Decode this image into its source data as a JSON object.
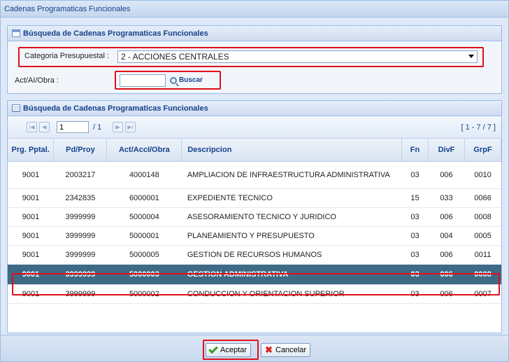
{
  "window": {
    "title": "Cadenas Programaticas Funcionales"
  },
  "search_panel": {
    "title": "Búsqueda de Cadenas Programaticas Funcionales",
    "category_label": "Categoria Presupuestal :",
    "category_value": "2 - ACCIONES CENTRALES",
    "act_label": "Act/AI/Obra :",
    "act_value": "",
    "search_button": "Buscar"
  },
  "grid_panel": {
    "title": "Búsqueda de Cadenas Programaticas Funcionales",
    "pager": {
      "page": "1",
      "of_pages": "/ 1",
      "range": "[ 1 - 7 / 7 ]"
    },
    "columns": [
      "Prg. Pptal.",
      "Pd/Proy",
      "Act/AccI/Obra",
      "Descripcion",
      "Fn",
      "DivF",
      "GrpF"
    ],
    "rows": [
      [
        "9001",
        "2003217",
        "4000148",
        "AMPLIACION DE INFRAESTRUCTURA ADMINISTRATIVA",
        "03",
        "006",
        "0010"
      ],
      [
        "9001",
        "2342835",
        "6000001",
        "EXPEDIENTE TECNICO",
        "15",
        "033",
        "0066"
      ],
      [
        "9001",
        "3999999",
        "5000004",
        "ASESORAMIENTO TECNICO Y JURIDICO",
        "03",
        "006",
        "0008"
      ],
      [
        "9001",
        "3999999",
        "5000001",
        "PLANEAMIENTO Y PRESUPUESTO",
        "03",
        "004",
        "0005"
      ],
      [
        "9001",
        "3999999",
        "5000005",
        "GESTION DE RECURSOS HUMANOS",
        "03",
        "006",
        "0011"
      ],
      [
        "9001",
        "3999999",
        "5000003",
        "GESTION ADMINISTRATIVA",
        "03",
        "006",
        "0008"
      ],
      [
        "9001",
        "3999999",
        "5000002",
        "CONDUCCION Y ORIENTACION SUPERIOR",
        "03",
        "006",
        "0007"
      ]
    ],
    "selected_row": 5
  },
  "footer": {
    "accept": "Aceptar",
    "cancel": "Cancelar"
  },
  "colors": {
    "selected_row": "#3f6a86",
    "highlight": "#e0101a",
    "header_text": "#15428b"
  }
}
